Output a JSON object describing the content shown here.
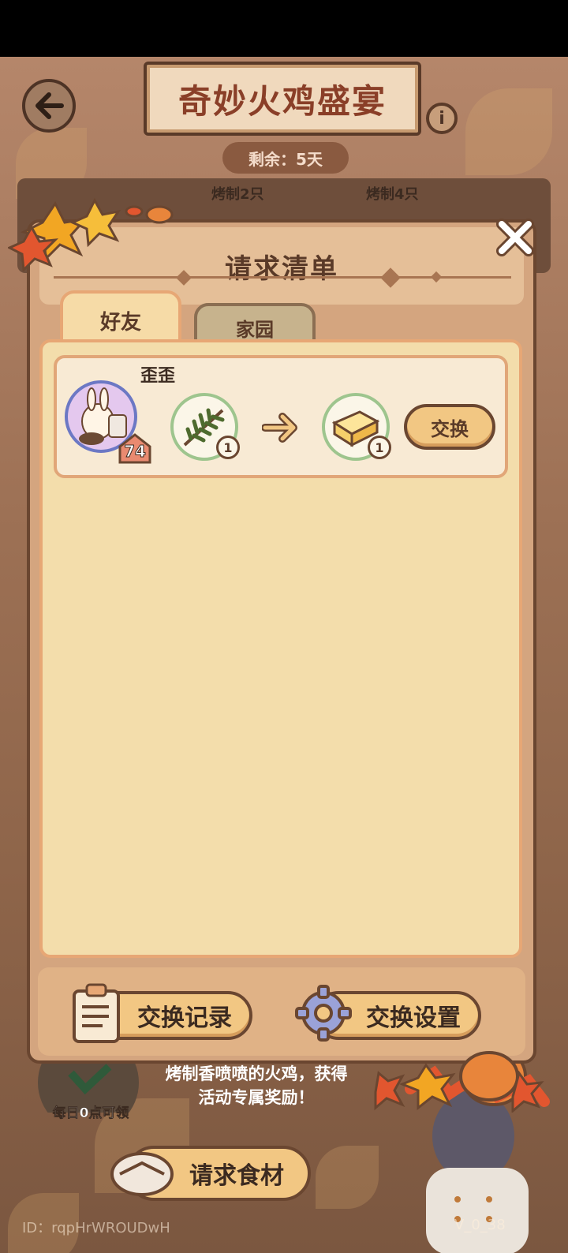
{
  "header": {
    "title": "奇妙火鸡盛宴",
    "remaining": "剩余：5天"
  },
  "bake_progress": {
    "milestone_1": "烤制2只",
    "milestone_2": "烤制4只"
  },
  "dialog": {
    "title": "请求清单",
    "tabs": [
      {
        "label": "好友",
        "active": true
      },
      {
        "label": "家园",
        "active": false
      }
    ],
    "requests": [
      {
        "friend_name": "歪歪",
        "level": "74",
        "give_item": {
          "icon": "rosemary-icon",
          "qty": "1"
        },
        "receive_item": {
          "icon": "butter-icon",
          "qty": "1"
        },
        "action_label": "交换"
      }
    ],
    "footer": {
      "record_label": "交换记录",
      "settings_label": "交换设置"
    }
  },
  "background": {
    "daily_label": "每日0点可领",
    "description_line1": "烤制香喷喷的火鸡，获得",
    "description_line2": "活动专属奖励！",
    "request_button": "请求食材",
    "id_label": "ID：rqpHrWROUDwH",
    "version_label": "V_0_38"
  },
  "colors": {
    "panel_brown": "#d4a57f",
    "content_cream": "#f3ddab",
    "button_gold": "#f2c783",
    "border_dark": "#6a4630",
    "title_red": "#8a3f28"
  }
}
